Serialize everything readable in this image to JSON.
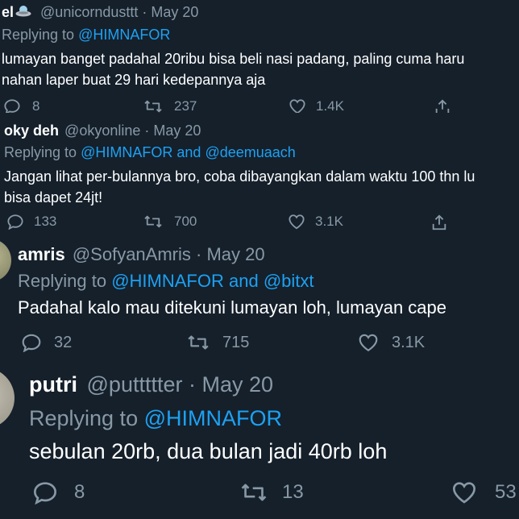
{
  "theme": {
    "background": "#15202b",
    "text": "#ffffff",
    "muted": "#8899a6",
    "link": "#1da1f2"
  },
  "tweets": [
    {
      "name": "el",
      "emoji": "ufo-emoji",
      "handle": "@unicorndusttt",
      "sep": "·",
      "date": "May 20",
      "replying_prefix": "Replying to",
      "mention1": "@HIMNAFOR",
      "mention_join": "",
      "mention2": "",
      "lines": [
        "lumayan banget padahal 20ribu bisa beli nasi padang, paling cuma haru",
        "nahan laper buat 29 hari kedepannya aja"
      ],
      "replies": "8",
      "retweets": "237",
      "likes": "1.4K"
    },
    {
      "name": "oky deh",
      "handle": "@okyonline",
      "sep": "·",
      "date": "May 20",
      "replying_prefix": "Replying to",
      "mention1": "@HIMNAFOR",
      "mention_join": "and",
      "mention2": "@deemuaach",
      "lines": [
        "Jangan lihat per-bulannya bro, coba dibayangkan dalam waktu 100 thn lu",
        "bisa dapet 24jt!"
      ],
      "replies": "133",
      "retweets": "700",
      "likes": "3.1K"
    },
    {
      "name": "amris",
      "handle": "@SofyanAmris",
      "sep": "·",
      "date": "May 20",
      "replying_prefix": "Replying to",
      "mention1": "@HIMNAFOR",
      "mention_join": "and",
      "mention2": "@bitxt",
      "lines": [
        "Padahal kalo mau ditekuni lumayan loh, lumayan cape"
      ],
      "replies": "32",
      "retweets": "715",
      "likes": "3.1K"
    },
    {
      "name": "putri",
      "handle": "@puttttter",
      "sep": "·",
      "date": "May 20",
      "replying_prefix": "Replying to",
      "mention1": "@HIMNAFOR",
      "mention_join": "",
      "mention2": "",
      "lines": [
        "sebulan 20rb, dua bulan jadi 40rb loh"
      ],
      "replies": "8",
      "retweets": "13",
      "likes": "53"
    }
  ]
}
